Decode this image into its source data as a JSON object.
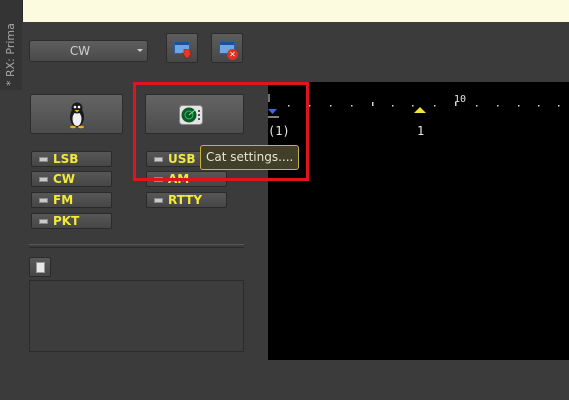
{
  "side_tab": {
    "label": "* RX: Prima"
  },
  "mode_select": {
    "value": "CW"
  },
  "toolbar": {
    "save_icon": "download-window-icon",
    "close_icon": "close-window-icon"
  },
  "big_buttons": [
    {
      "name": "penguin-button",
      "icon": "penguin-icon"
    },
    {
      "name": "cat-settings-button",
      "icon": "radar-icon"
    }
  ],
  "modes_left": [
    "LSB",
    "CW",
    "FM",
    "PKT"
  ],
  "modes_right": [
    "USB",
    "AM",
    "RTTY"
  ],
  "tooltip": {
    "text": "Cat settings...."
  },
  "display": {
    "scale_label": "10",
    "marker_label": "(1)",
    "center_label": "1"
  },
  "colors": {
    "mode_text": "#f2e93a",
    "highlight": "#e0141c",
    "tooltip_border": "#c8b23c"
  }
}
